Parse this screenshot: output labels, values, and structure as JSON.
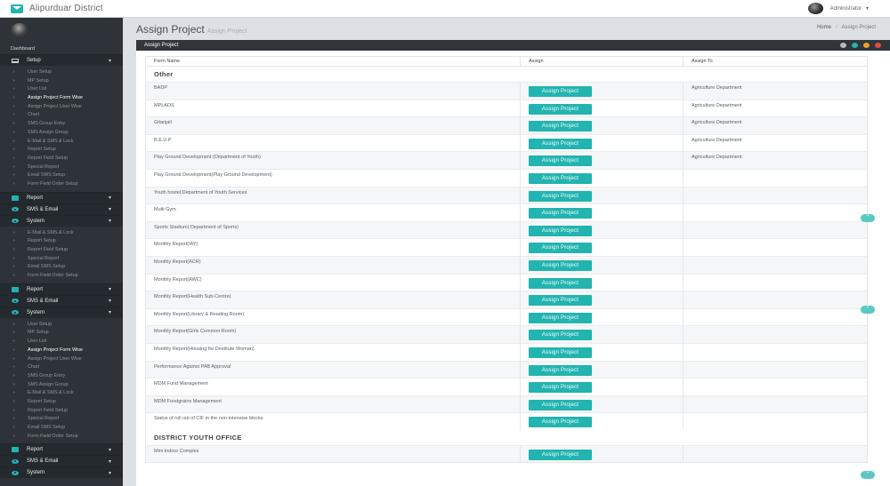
{
  "app": {
    "title": "Alipurduar District",
    "user": "Administrator"
  },
  "breadcrumb": {
    "home": "Home",
    "current": "Assign Project"
  },
  "page": {
    "title": "Assign Project",
    "subtitle": "Assign Project"
  },
  "panel": {
    "title": "Assign Project",
    "dot_colors": [
      "#b8bcbf",
      "#22b4b0",
      "#f0a22d",
      "#e74c3c"
    ]
  },
  "sidebar": {
    "section_label": "Dashboard",
    "groups": [
      {
        "label": "Setup",
        "icon": "laptop-icon"
      },
      {
        "label": "Report",
        "icon": "monitor-icon"
      },
      {
        "label": "SMS & Email",
        "icon": "eye-icon"
      },
      {
        "label": "System",
        "icon": "eye-icon"
      },
      {
        "label": "Report",
        "icon": "monitor-icon"
      },
      {
        "label": "SMS & Email",
        "icon": "eye-icon"
      },
      {
        "label": "System",
        "icon": "eye-icon"
      },
      {
        "label": "Report",
        "icon": "monitor-icon"
      },
      {
        "label": "SMS & Email",
        "icon": "eye-icon"
      },
      {
        "label": "System",
        "icon": "eye-icon"
      }
    ],
    "setup_items": [
      "User Setup",
      "MP Setup",
      "User List",
      "Assign Project Form Wise",
      "Assign Project User Wise",
      "Chart",
      "SMS Group Entry",
      "SMS Assign Group",
      "E-Mail & SMS & Lock",
      "Report Setup",
      "Report Field Setup",
      "Special Report",
      "Email SMS Setup",
      "Form Field Order Setup"
    ],
    "system_items": [
      "E-Mail & SMS & Lock",
      "Report Setup",
      "Report Field Setup",
      "Special Report",
      "Email SMS Setup",
      "Form Field Order Setup"
    ],
    "setup2_items": [
      "User Setup",
      "MP Setup",
      "User List",
      "Assign Project Form Wise",
      "Assign Project User Wise",
      "Chart",
      "SMS Group Entry",
      "SMS Assign Group",
      "E-Mail & SMS & Lock",
      "Report Setup",
      "Report Field Setup",
      "Special Report",
      "Email SMS Setup",
      "Form Field Order Setup"
    ],
    "active_item": "Assign Project Form Wise"
  },
  "table": {
    "headers": [
      "Form Name",
      "Assign",
      "Assign To"
    ],
    "button_label": "Assign Project",
    "groups": [
      {
        "name": "Other",
        "rows": [
          {
            "form": "BADP",
            "assign_to": "Agriculture Department"
          },
          {
            "form": "MPLADS",
            "assign_to": "Agriculture Department"
          },
          {
            "form": "Gitanjali",
            "assign_to": "Agriculture Department"
          },
          {
            "form": "B.E.U.P",
            "assign_to": "Agriculture Department"
          },
          {
            "form": "Play Ground Development (Department of Youth)",
            "assign_to": "Agriculture Department"
          },
          {
            "form": "Play Ground Development(Play Ground Development)",
            "assign_to": ""
          },
          {
            "form": "Youth hostel,Department of Youth Services",
            "assign_to": ""
          },
          {
            "form": "Multi Gym",
            "assign_to": ""
          },
          {
            "form": "Sports Stadium( Department of Sports)",
            "assign_to": ""
          },
          {
            "form": "Monthly Report(IAY)",
            "assign_to": ""
          },
          {
            "form": "Monthly Report(ACR)",
            "assign_to": ""
          },
          {
            "form": "Monthly Report(AWC)",
            "assign_to": ""
          },
          {
            "form": "Monthly Report(Health Sub-Centre)",
            "assign_to": ""
          },
          {
            "form": "Monthly Report(Library & Reading Room)",
            "assign_to": ""
          },
          {
            "form": "Monthly Report(Girls Common Room)",
            "assign_to": ""
          },
          {
            "form": "Monthly Report(Housing for Destitute Woman)",
            "assign_to": ""
          },
          {
            "form": "Performance Against PAB Approval",
            "assign_to": ""
          },
          {
            "form": "MDM Fund Management",
            "assign_to": ""
          },
          {
            "form": "MDM Foodgrains Management",
            "assign_to": ""
          },
          {
            "form": "Status of roll out of CIF in the non-intensive blocks",
            "assign_to": ""
          }
        ]
      },
      {
        "name": "DISTRICT YOUTH OFFICE",
        "rows": [
          {
            "form": "Mini Indoor Complex",
            "assign_to": ""
          }
        ]
      }
    ]
  }
}
